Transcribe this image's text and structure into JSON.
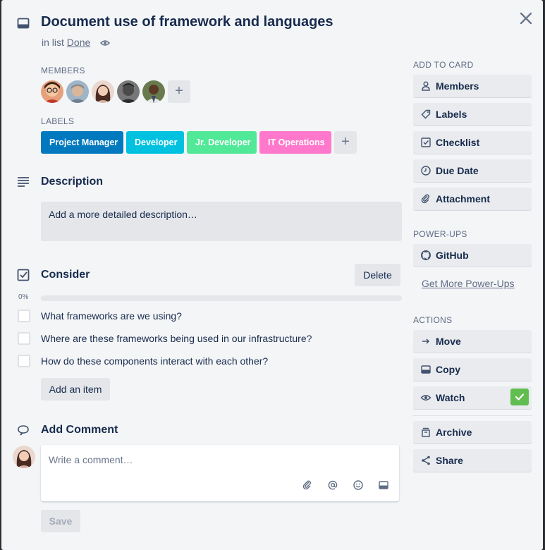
{
  "header": {
    "title": "Document use of framework and languages",
    "in_list_prefix": "in list",
    "list_name": "Done"
  },
  "members": {
    "section_label": "MEMBERS",
    "add_label": "+"
  },
  "labels": {
    "section_label": "LABELS",
    "items": [
      {
        "text": "Project Manager",
        "color": "#0079bf"
      },
      {
        "text": "Developer",
        "color": "#00c2e0"
      },
      {
        "text": "Jr. Developer",
        "color": "#51e898"
      },
      {
        "text": "IT Operations",
        "color": "#ff78cb"
      }
    ],
    "add_label": "+"
  },
  "description": {
    "heading": "Description",
    "placeholder": "Add a more detailed description…"
  },
  "checklist": {
    "heading": "Consider",
    "delete_label": "Delete",
    "progress_text": "0%",
    "progress": 0,
    "items": [
      {
        "text": "What frameworks are we using?",
        "checked": false
      },
      {
        "text": "Where are these frameworks being used in our infrastructure?",
        "checked": false
      },
      {
        "text": "How do these components interact with each other?",
        "checked": false
      }
    ],
    "add_item_label": "Add an item"
  },
  "comment": {
    "heading": "Add Comment",
    "placeholder": "Write a comment…",
    "save_label": "Save"
  },
  "sidebar": {
    "add_to_card_label": "ADD TO CARD",
    "add_to_card": [
      {
        "label": "Members",
        "icon": "person-icon"
      },
      {
        "label": "Labels",
        "icon": "tag-icon"
      },
      {
        "label": "Checklist",
        "icon": "checkbox-icon"
      },
      {
        "label": "Due Date",
        "icon": "clock-icon"
      },
      {
        "label": "Attachment",
        "icon": "paperclip-icon"
      }
    ],
    "power_ups_label": "POWER-UPS",
    "power_ups": [
      {
        "label": "GitHub",
        "icon": "github-icon"
      }
    ],
    "get_more_label": "Get More Power-Ups",
    "actions_label": "ACTIONS",
    "actions": [
      {
        "label": "Move",
        "icon": "arrow-right-icon"
      },
      {
        "label": "Copy",
        "icon": "card-icon"
      },
      {
        "label": "Watch",
        "icon": "eye-icon",
        "active": true
      },
      {
        "label": "Archive",
        "icon": "archive-icon"
      },
      {
        "label": "Share",
        "icon": "share-icon"
      }
    ]
  },
  "colors": {
    "accent_check": "#61bd4f",
    "card_bg": "#f4f5f7",
    "button_bg": "#e4e6ea"
  }
}
